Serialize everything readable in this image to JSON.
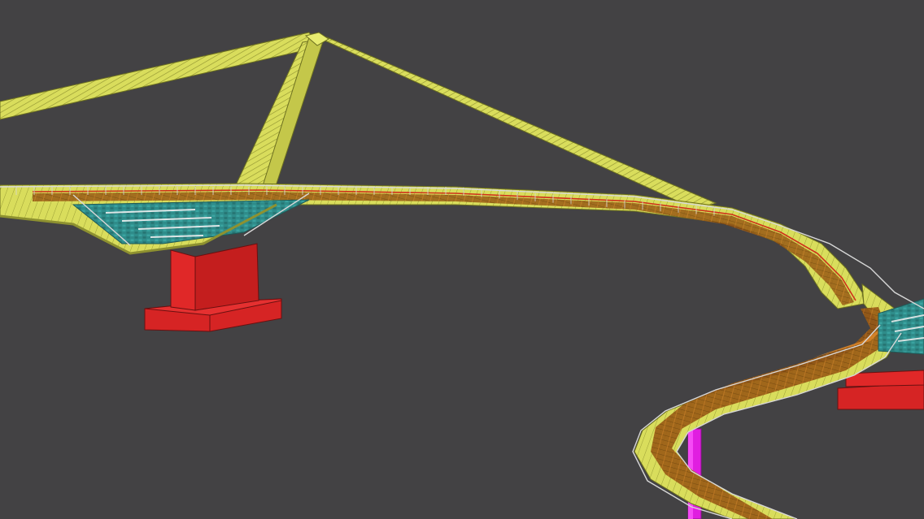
{
  "scene": {
    "kind": "3D bridge model viewport",
    "colors": {
      "background": "#434244",
      "structure": "#d9dd5c",
      "structure_shade": "#b7bb3f",
      "pier": "#d62424",
      "pier_shade": "#a81a1a",
      "deck_wood": "#9a5a14",
      "deck_accent": "#e08a2a",
      "stair_tile": "#2f8c8a",
      "railing": "#d8d8d8",
      "rail_red": "#d0301a",
      "column": "#e01ee0"
    }
  }
}
